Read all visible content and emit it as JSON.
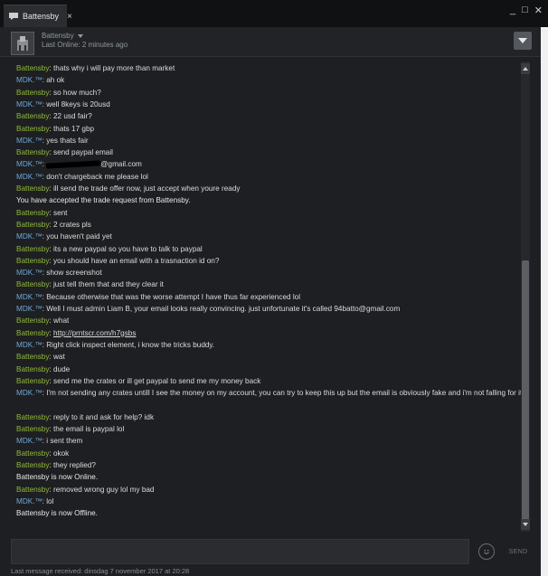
{
  "window": {
    "tab_title": "Battensby",
    "tab_close": "×",
    "controls": {
      "minimize": "_",
      "maximize": "□",
      "close": "✕"
    }
  },
  "header": {
    "name": "Battensby",
    "status": "Last Online: 2 minutes ago",
    "dropdown_icon": "chevron-down-icon"
  },
  "messages": [
    {
      "sender": "Battensby",
      "speaker": "b",
      "text": "thats why i will pay more than market"
    },
    {
      "sender": "MDK.™",
      "speaker": "m",
      "text": "ah ok"
    },
    {
      "sender": "Battensby",
      "speaker": "b",
      "text": "so how much?"
    },
    {
      "sender": "MDK.™",
      "speaker": "m",
      "text": "well 8keys is 20usd"
    },
    {
      "sender": "Battensby",
      "speaker": "b",
      "text": "22 usd fair?"
    },
    {
      "sender": "Battensby",
      "speaker": "b",
      "text": "thats 17 gbp"
    },
    {
      "sender": "MDK.™",
      "speaker": "m",
      "text": "yes thats fair"
    },
    {
      "sender": "Battensby",
      "speaker": "b",
      "text": "send paypal email"
    },
    {
      "sender": "MDK.™",
      "speaker": "m",
      "text": "@gmail.com",
      "redacted": true
    },
    {
      "sender": "MDK.™",
      "speaker": "m",
      "text": "don't chargeback me please lol"
    },
    {
      "sender": "Battensby",
      "speaker": "b",
      "text": "ill send the trade offer now, just accept when youre ready"
    },
    {
      "sender": "",
      "speaker": "sys",
      "text": "You have accepted the trade request from Battensby."
    },
    {
      "sender": "Battensby",
      "speaker": "b",
      "text": "sent"
    },
    {
      "sender": "Battensby",
      "speaker": "b",
      "text": "2 crates pls"
    },
    {
      "sender": "MDK.™",
      "speaker": "m",
      "text": "you haven't paid yet"
    },
    {
      "sender": "Battensby",
      "speaker": "b",
      "text": "its a new paypal so you have to talk to paypal"
    },
    {
      "sender": "Battensby",
      "speaker": "b",
      "text": "you should have an email with a trasnaction id on?"
    },
    {
      "sender": "MDK.™",
      "speaker": "m",
      "text": "show screenshot"
    },
    {
      "sender": "Battensby",
      "speaker": "b",
      "text": "just tell them that and they clear it"
    },
    {
      "sender": "MDK.™",
      "speaker": "m",
      "text": "Because otherwise that was the worse attempt I have thus far experienced lol"
    },
    {
      "sender": "MDK.™",
      "speaker": "m",
      "text": "Well I must admin Liam B, your email looks really convincing. just unfortunate it's called 94batto@gmail.com"
    },
    {
      "sender": "Battensby",
      "speaker": "b",
      "text": "what"
    },
    {
      "sender": "Battensby",
      "speaker": "b",
      "text": "http://prntscr.com/h7gsbs",
      "link": true
    },
    {
      "sender": "MDK.™",
      "speaker": "m",
      "text": "Right click inspect element, i know the tricks buddy."
    },
    {
      "sender": "Battensby",
      "speaker": "b",
      "text": "wat"
    },
    {
      "sender": "Battensby",
      "speaker": "b",
      "text": "dude"
    },
    {
      "sender": "Battensby",
      "speaker": "b",
      "text": "send me the crates or ill get paypal to send me my money back"
    },
    {
      "sender": "MDK.™",
      "speaker": "m",
      "text": "I'm not sending any crates untill I see the money on my account, you can try to keep this up but the email is obviously fake and i'm not falling for it",
      "wrap": true
    },
    {
      "sender": "Battensby",
      "speaker": "b",
      "text": "reply to it and ask for help? idk"
    },
    {
      "sender": "Battensby",
      "speaker": "b",
      "text": "the email is paypal lol"
    },
    {
      "sender": "MDK.™",
      "speaker": "m",
      "text": "i sent them"
    },
    {
      "sender": "Battensby",
      "speaker": "b",
      "text": "okok"
    },
    {
      "sender": "Battensby",
      "speaker": "b",
      "text": "they replied?"
    },
    {
      "sender": "",
      "speaker": "sys",
      "text": "Battensby is now Online."
    },
    {
      "sender": "Battensby",
      "speaker": "b",
      "text": "removed wrong guy lol my bad"
    },
    {
      "sender": "MDK.™",
      "speaker": "m",
      "text": "lol"
    },
    {
      "sender": "",
      "speaker": "sys",
      "text": "Battensby is now Offline."
    }
  ],
  "composer": {
    "placeholder": "",
    "send_label": "SEND",
    "emoji_icon": "smiley-icon"
  },
  "footer": {
    "last_received": "Last message received: dinsdag 7 november 2017 at 20:28"
  },
  "colors": {
    "sender_b": "#90ba3c",
    "sender_m": "#6fa9d8",
    "background": "#1e1f22"
  }
}
